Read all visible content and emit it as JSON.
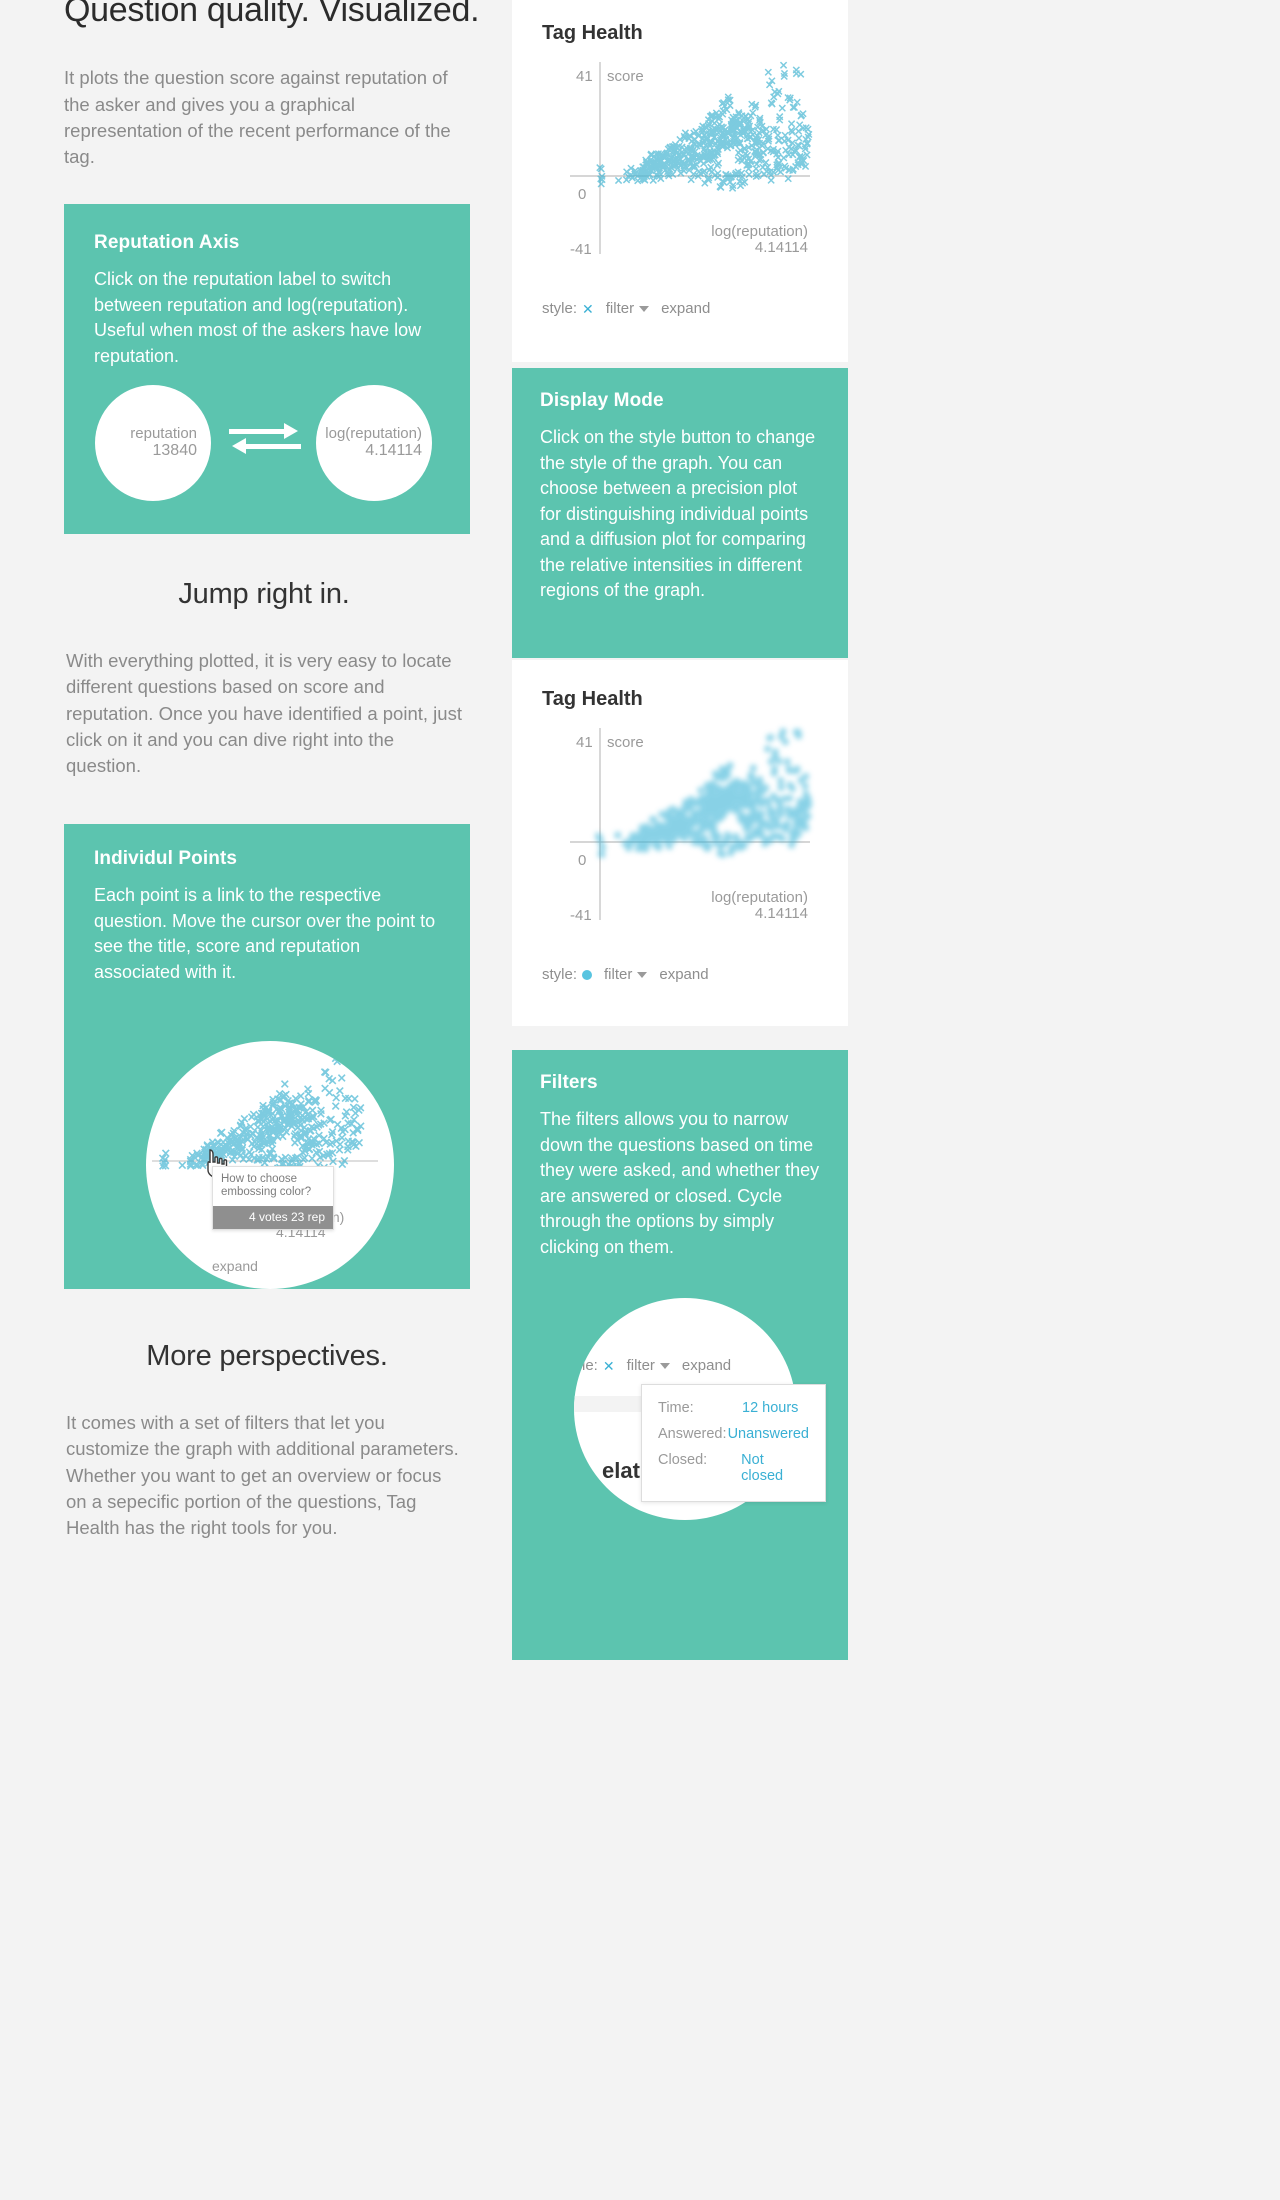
{
  "theme": {
    "teal": "#5cc4af",
    "page_bg": "#f3f3f3",
    "accent_blue": "#3ab0d4",
    "muted": "#8a8a8a"
  },
  "left": {
    "hero_title": "Question quality. Visualized.",
    "lead": "It plots the question score against reputation of the asker and gives you a graphical representation of the recent performance of the tag.",
    "reputation_card": {
      "title": "Reputation Axis",
      "body": "Click on the reputation label to switch between reputation and log(reputation). Useful when most of the askers have low reputation.",
      "left_circle": {
        "label": "reputation",
        "value": "13840"
      },
      "right_circle": {
        "label": "log(reputation)",
        "value": "4.14114"
      },
      "swap_icon": "swap-arrows-icon"
    },
    "jump_title": "Jump right in.",
    "jump_body": "With everything plotted, it is very easy to locate different questions based on score and reputation. Once you have identified a point, just click on it and you can dive right into the question.",
    "points_card": {
      "title": "Individul Points",
      "body": "Each point is a link to the respective question. Move the cursor over the point to see the title, score and reputation associated with it.",
      "tooltip": {
        "title": "How to choose embossing color?",
        "meta": "4 votes 23 rep"
      },
      "xlabel": "log(reputation)",
      "xvalue": "4.14114",
      "expand_label": "expand",
      "cursor_icon": "pointing-hand-cursor-icon"
    },
    "more_title": "More perspectives.",
    "more_body": "It comes with a set of filters that let you customize the graph with additional parameters. Whether you want to get an overview or focus on a sepecific portion of the questions, Tag Health has the right tools for you."
  },
  "right": {
    "chart_precision": {
      "title": "Tag Health",
      "toolbar": {
        "style_label": "style:",
        "style_value_icon": "x-mark-icon",
        "filter_label": "filter",
        "expand_label": "expand"
      }
    },
    "display_mode_card": {
      "title": "Display Mode",
      "body": "Click on the style button to change the style of the graph. You can choose between a precision plot for distinguishing individual points and a diffusion plot for comparing the relative intensities in different regions of the graph."
    },
    "chart_diffusion": {
      "title": "Tag Health",
      "toolbar": {
        "style_label": "style:",
        "style_value_icon": "dot-mark-icon",
        "filter_label": "filter",
        "expand_label": "expand"
      }
    },
    "filters_card": {
      "title": "Filters",
      "body": "The filters allows you to narrow down the questions based on time they were asked, and whether they are answered or closed. Cycle through the options by simply clicking on them.",
      "toolbar": {
        "style_label": "le:",
        "style_value_icon": "x-mark-icon",
        "filter_label": "filter",
        "expand_label": "expand"
      },
      "behind_text": "elat",
      "dropdown": {
        "rows": [
          {
            "key": "Time:",
            "value": "12 hours"
          },
          {
            "key": "Answered:",
            "value": "Unanswered"
          },
          {
            "key": "Closed:",
            "value": "Not closed"
          }
        ]
      }
    }
  },
  "chart_data": [
    {
      "id": "precision-plot",
      "type": "scatter",
      "title": "Tag Health",
      "xlabel": "log(reputation)",
      "ylabel": "score",
      "marker": "x",
      "marker_color": "#4cb8d4",
      "xlim": [
        0,
        4.14114
      ],
      "ylim": [
        -41,
        41
      ],
      "yticks": [
        41,
        0,
        -41
      ],
      "ytick_labels": [
        "41",
        "0",
        "-41"
      ],
      "xtick_labels": [
        "4.14114"
      ],
      "grid": false,
      "legend": "none",
      "points": [
        [
          0.0,
          0
        ],
        [
          0.01,
          0
        ],
        [
          0.02,
          -1
        ],
        [
          0.03,
          1
        ],
        [
          0.02,
          -3
        ],
        [
          0.0,
          -2
        ],
        [
          0.34,
          0
        ],
        [
          0.52,
          0
        ],
        [
          0.56,
          0
        ],
        [
          0.58,
          1
        ],
        [
          0.6,
          0
        ],
        [
          0.62,
          0
        ],
        [
          0.64,
          1
        ],
        [
          0.66,
          0
        ],
        [
          0.7,
          1
        ],
        [
          0.72,
          0
        ],
        [
          0.74,
          2
        ],
        [
          0.76,
          0
        ],
        [
          0.78,
          1
        ],
        [
          0.8,
          3
        ],
        [
          0.82,
          0
        ],
        [
          0.84,
          2
        ],
        [
          0.86,
          1
        ],
        [
          0.88,
          4
        ],
        [
          0.9,
          0
        ],
        [
          0.92,
          3
        ],
        [
          0.94,
          2
        ],
        [
          0.96,
          5
        ],
        [
          0.98,
          1
        ],
        [
          1.0,
          4
        ],
        [
          1.02,
          2
        ],
        [
          1.04,
          6
        ],
        [
          1.06,
          3
        ],
        [
          1.08,
          1
        ],
        [
          1.1,
          5
        ],
        [
          1.12,
          2
        ],
        [
          1.14,
          7
        ],
        [
          1.16,
          4
        ],
        [
          1.18,
          0
        ],
        [
          1.2,
          6
        ],
        [
          1.22,
          3
        ],
        [
          1.24,
          8
        ],
        [
          1.26,
          5
        ],
        [
          1.28,
          2
        ],
        [
          1.3,
          7
        ],
        [
          1.32,
          4
        ],
        [
          1.34,
          9
        ],
        [
          1.36,
          1
        ],
        [
          1.38,
          6
        ],
        [
          1.4,
          3
        ],
        [
          1.42,
          8
        ],
        [
          1.44,
          5
        ],
        [
          1.46,
          10
        ],
        [
          1.48,
          2
        ],
        [
          1.5,
          7
        ],
        [
          1.52,
          4
        ],
        [
          1.54,
          9
        ],
        [
          1.56,
          6
        ],
        [
          1.58,
          11
        ],
        [
          1.6,
          3
        ],
        [
          1.62,
          8
        ],
        [
          1.64,
          5
        ],
        [
          1.66,
          12
        ],
        [
          1.68,
          2
        ],
        [
          1.7,
          9
        ],
        [
          1.72,
          6
        ],
        [
          1.74,
          13
        ],
        [
          1.76,
          4
        ],
        [
          1.78,
          10
        ],
        [
          1.8,
          7
        ],
        [
          1.82,
          1
        ],
        [
          1.84,
          14
        ],
        [
          1.86,
          5
        ],
        [
          1.88,
          11
        ],
        [
          1.9,
          8
        ],
        [
          1.92,
          2
        ],
        [
          1.94,
          15
        ],
        [
          1.96,
          6
        ],
        [
          1.98,
          12
        ],
        [
          2.0,
          9
        ],
        [
          2.02,
          3
        ],
        [
          2.04,
          16
        ],
        [
          2.06,
          7
        ],
        [
          2.08,
          13
        ],
        [
          2.1,
          10
        ],
        [
          2.12,
          0
        ],
        [
          2.14,
          18
        ],
        [
          2.16,
          8
        ],
        [
          2.18,
          14
        ],
        [
          2.2,
          11
        ],
        [
          2.22,
          4
        ],
        [
          2.24,
          20
        ],
        [
          2.26,
          9
        ],
        [
          2.28,
          15
        ],
        [
          2.3,
          12
        ],
        [
          2.32,
          2
        ],
        [
          2.34,
          22
        ],
        [
          2.36,
          10
        ],
        [
          2.38,
          16
        ],
        [
          2.4,
          13
        ],
        [
          2.42,
          -3
        ],
        [
          2.44,
          24
        ],
        [
          2.46,
          11
        ],
        [
          2.48,
          17
        ],
        [
          2.5,
          14
        ],
        [
          2.52,
          1
        ],
        [
          2.55,
          26
        ],
        [
          2.58,
          12
        ],
        [
          2.6,
          18
        ],
        [
          2.62,
          15
        ],
        [
          2.64,
          -2
        ],
        [
          2.66,
          20
        ],
        [
          2.68,
          13
        ],
        [
          2.7,
          19
        ],
        [
          2.72,
          16
        ],
        [
          2.74,
          0
        ],
        [
          2.76,
          21
        ],
        [
          2.78,
          14
        ],
        [
          2.8,
          8
        ],
        [
          2.82,
          17
        ],
        [
          2.84,
          -1
        ],
        [
          2.86,
          22
        ],
        [
          2.88,
          15
        ],
        [
          2.9,
          9
        ],
        [
          2.92,
          18
        ],
        [
          2.95,
          3
        ],
        [
          2.98,
          12
        ],
        [
          3.0,
          6
        ],
        [
          3.02,
          16
        ],
        [
          3.05,
          24
        ],
        [
          3.08,
          10
        ],
        [
          3.1,
          2
        ],
        [
          3.12,
          14
        ],
        [
          3.15,
          7
        ],
        [
          3.18,
          20
        ],
        [
          3.2,
          5
        ],
        [
          3.22,
          11
        ],
        [
          3.25,
          1
        ],
        [
          3.28,
          17
        ],
        [
          3.3,
          8
        ],
        [
          3.32,
          3
        ],
        [
          3.35,
          13
        ],
        [
          3.38,
          35
        ],
        [
          3.4,
          0
        ],
        [
          3.42,
          9
        ],
        [
          3.45,
          27
        ],
        [
          3.48,
          4
        ],
        [
          3.5,
          15
        ],
        [
          3.52,
          30
        ],
        [
          3.55,
          6
        ],
        [
          3.58,
          11
        ],
        [
          3.6,
          2
        ],
        [
          3.62,
          22
        ],
        [
          3.65,
          38
        ],
        [
          3.68,
          5
        ],
        [
          3.7,
          14
        ],
        [
          3.72,
          8
        ],
        [
          3.75,
          28
        ],
        [
          3.78,
          1
        ],
        [
          3.8,
          10
        ],
        [
          3.82,
          18
        ],
        [
          3.85,
          3
        ],
        [
          3.88,
          25
        ],
        [
          3.9,
          7
        ],
        [
          3.92,
          12
        ],
        [
          3.95,
          38
        ],
        [
          3.98,
          5
        ],
        [
          4.0,
          16
        ],
        [
          4.02,
          9
        ],
        [
          4.05,
          21
        ],
        [
          4.08,
          6
        ],
        [
          4.1,
          13
        ],
        [
          4.12,
          11
        ],
        [
          4.14,
          17
        ]
      ]
    },
    {
      "id": "diffusion-plot",
      "type": "scatter",
      "title": "Tag Health",
      "xlabel": "log(reputation)",
      "ylabel": "score",
      "marker": "blurred-dot",
      "marker_color": "#3fb6d8",
      "xlim": [
        0,
        4.14114
      ],
      "ylim": [
        -41,
        41
      ],
      "yticks": [
        41,
        0,
        -41
      ],
      "ytick_labels": [
        "41",
        "0",
        "-41"
      ],
      "xtick_labels": [
        "4.14114"
      ],
      "grid": false,
      "legend": "none",
      "note": "Same underlying data as precision-plot rendered as a soft density / diffusion plot"
    }
  ]
}
